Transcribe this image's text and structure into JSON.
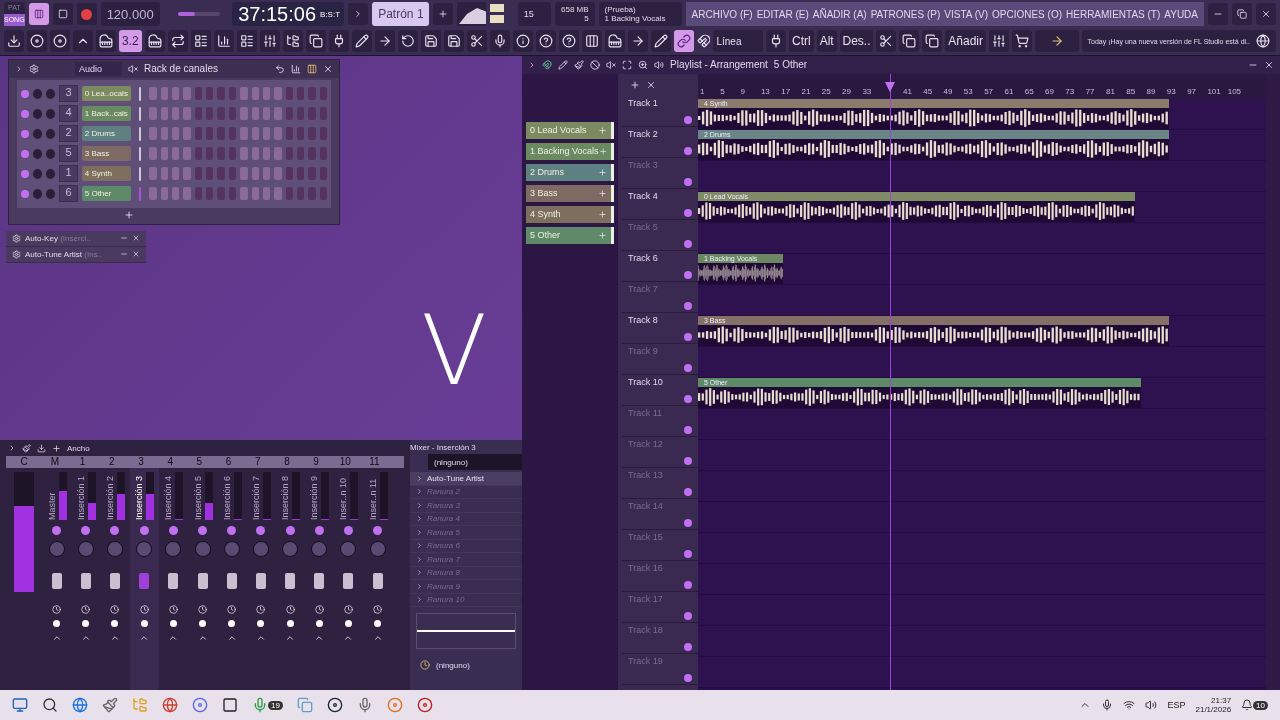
{
  "transport": {
    "mode_top": "PAT",
    "mode_bottom": "SONG",
    "tempo": "120.000",
    "time": "37:15:06",
    "master_volume": {
      "level": 0.4
    },
    "time_format": "B:S:T",
    "pattern": "Patrón 1",
    "memory": "658 MB",
    "cpu": "15",
    "polyphony": "5",
    "hint_title": "(Prueba)",
    "hint_text": "1 Backing Vocals"
  },
  "menu": [
    "ARCHIVO (F)",
    "EDITAR (E)",
    "AÑADIR (A)",
    "PATRONES (P)",
    "VISTA (V)",
    "OPCIONES (O)",
    "HERRAMIENTAS (T)",
    "AYUDA"
  ],
  "toolbar": {
    "snap_label": "3.2",
    "snap_mode": "Línea",
    "keys": [
      "Ctrl",
      "Alt",
      "Des.."
    ],
    "add": "Añadir",
    "news_day": "Today",
    "news_text": "¡Hay una nueva versión de FL Studio está di.."
  },
  "channel_rack": {
    "filter": "Audio",
    "title": "Rack de canales",
    "channels": [
      {
        "number": "3",
        "name": "0 Lea..ocals",
        "color": "#7c8a62",
        "selected": false
      },
      {
        "number": "4",
        "name": "1 Back..cals",
        "color": "#6a8a62",
        "selected": false
      },
      {
        "number": "2",
        "name": "2 Drums",
        "color": "#5f8080",
        "selected": false
      },
      {
        "number": "5",
        "name": "3 Bass",
        "color": "#7e6a62",
        "selected": false
      },
      {
        "number": "1",
        "name": "4 Synth",
        "color": "#7e6e5e",
        "selected": false
      },
      {
        "number": "6",
        "name": "5 Other",
        "color": "#5e8a6a",
        "selected": true
      }
    ]
  },
  "plugins": [
    {
      "name": "Auto-Key",
      "detail": "(Inserci.."
    },
    {
      "name": "Auto-Tune Artist",
      "detail": "(Ins.."
    }
  ],
  "logo": "V",
  "mixer": {
    "toolbar_label": "Ancho",
    "title": "Mixer - Inserción 3",
    "main_meter": {
      "level": 0.72
    },
    "columns": [
      "C",
      "M",
      "1",
      "2",
      "3",
      "4",
      "5",
      "6",
      "7",
      "8",
      "9",
      "10",
      "11"
    ],
    "strips": [
      {
        "name": "Master",
        "level": 0.6,
        "selected": false
      },
      {
        "name": "Inserción 1",
        "level": 0.35,
        "selected": false
      },
      {
        "name": "Inserción 2",
        "level": 0.55,
        "selected": false
      },
      {
        "name": "Inserción 3",
        "level": 0.55,
        "selected": true
      },
      {
        "name": "Inserción 4",
        "level": 0,
        "selected": false
      },
      {
        "name": "Inserción 5",
        "level": 0.35,
        "selected": false
      },
      {
        "name": "Inserción 6",
        "level": 0,
        "selected": false
      },
      {
        "name": "Inserción 7",
        "level": 0,
        "selected": false
      },
      {
        "name": "Inserción 8",
        "level": 0,
        "selected": false
      },
      {
        "name": "Inserción 9",
        "level": 0,
        "selected": false
      },
      {
        "name": "Inser..n 10",
        "level": 0,
        "selected": false
      },
      {
        "name": "Inser..n 11",
        "level": 0,
        "selected": false
      }
    ],
    "input": "(ninguno)",
    "slots": [
      {
        "name": "Auto-Tune Artist",
        "active": true
      },
      {
        "name": "Ranura 2",
        "active": false
      },
      {
        "name": "Ranura 3",
        "active": false
      },
      {
        "name": "Ranura 4",
        "active": false
      },
      {
        "name": "Ranura 5",
        "active": false
      },
      {
        "name": "Ranura 6",
        "active": false
      },
      {
        "name": "Ranura 7",
        "active": false
      },
      {
        "name": "Ranura 8",
        "active": false
      },
      {
        "name": "Ranura 9",
        "active": false
      },
      {
        "name": "Ranura 10",
        "active": false
      }
    ],
    "output": "(ninguno)"
  },
  "playlist": {
    "title": "Playlist - Arrangement",
    "pattern": "5 Other",
    "patterns": [
      {
        "name": "0 Lead Vocals",
        "color": "#7c8a62"
      },
      {
        "name": "1 Backing Vocals",
        "color": "#6a8a62"
      },
      {
        "name": "2 Drums",
        "color": "#5f8080"
      },
      {
        "name": "3 Bass",
        "color": "#7e6a62"
      },
      {
        "name": "4 Synth",
        "color": "#7e6e5e"
      },
      {
        "name": "5 Other",
        "color": "#5e8a6a"
      }
    ],
    "ruler": [
      "1",
      "5",
      "9",
      "13",
      "17",
      "21",
      "25",
      "29",
      "33",
      "41",
      "45",
      "49",
      "53",
      "57",
      "61",
      "65",
      "69",
      "73",
      "77",
      "81",
      "85",
      "89",
      "93",
      "97",
      "101",
      "105"
    ],
    "playhead": {
      "level": 0.338
    },
    "tracks": [
      {
        "name": "Track 1",
        "clip": {
          "label": "4 Synth",
          "color": "#8a7b6c",
          "level": 0.83
        }
      },
      {
        "name": "Track 2",
        "clip": {
          "label": "2 Drums",
          "color": "#6a8585",
          "level": 0.83
        }
      },
      {
        "name": "Track 3"
      },
      {
        "name": "Track 4",
        "clip": {
          "label": "0 Lead Vocals",
          "color": "#7f8a66",
          "level": 0.77
        }
      },
      {
        "name": "Track 5"
      },
      {
        "name": "Track 6",
        "clip": {
          "label": "1 Backing Vocals",
          "color": "#6c8862",
          "level": 0.15
        }
      },
      {
        "name": "Track 7"
      },
      {
        "name": "Track 8",
        "clip": {
          "label": "3 Bass",
          "color": "#857068",
          "level": 0.83
        }
      },
      {
        "name": "Track 9"
      },
      {
        "name": "Track 10",
        "clip": {
          "label": "5 Other",
          "color": "#5f8a6a",
          "level": 0.78
        }
      },
      {
        "name": "Track 11"
      },
      {
        "name": "Track 12"
      },
      {
        "name": "Track 13"
      },
      {
        "name": "Track 14"
      },
      {
        "name": "Track 15"
      },
      {
        "name": "Track 16"
      },
      {
        "name": "Track 17"
      },
      {
        "name": "Track 18"
      },
      {
        "name": "Track 19"
      }
    ]
  },
  "taskbar": {
    "whatsapp_badge": "19",
    "language": "ESP",
    "time": "21:37",
    "date": "21/1/2026",
    "notifications": "10"
  }
}
